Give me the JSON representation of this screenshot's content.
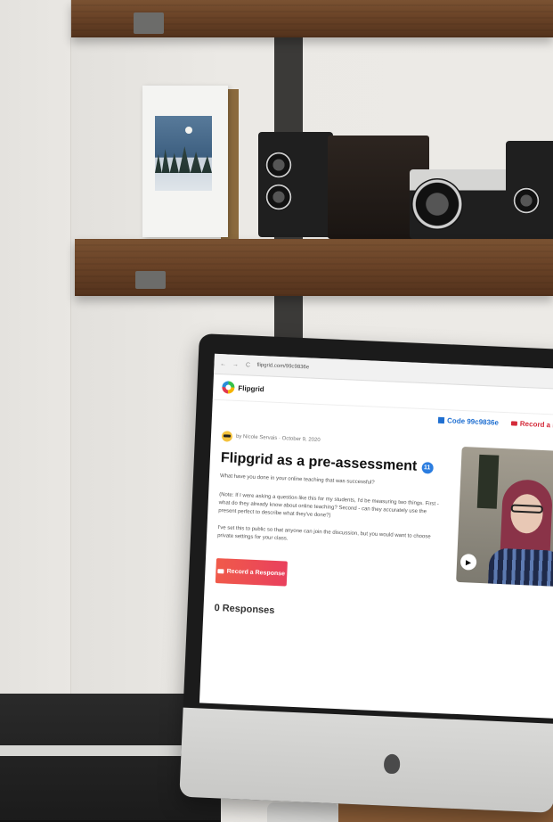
{
  "browser": {
    "url": "flipgrid.com/99c9836e",
    "nav_back": "←",
    "nav_forward": "→",
    "reload": "C"
  },
  "app": {
    "brand": "Flipgrid",
    "code_label": "Code 99c9836e",
    "record_top_label": "Record a Resp",
    "meta": "by Nicole Servais · October 9, 2020",
    "title": "Flipgrid as a pre-assessment",
    "title_badge": "11",
    "prompt": "What have you done in your online teaching that was successful?",
    "body": "(Note: If I were asking a question like this for my students, I'd be measuring two things. First - what do they already know about online teaching? Second - can they accurately use the present perfect to describe what they've done?)",
    "note": "I've set this to public so that anyone can join the discussion, but you would want to choose private settings for your class.",
    "record_button": "Record a Response",
    "responses": "0 Responses",
    "play_icon": "▶"
  },
  "colors": {
    "accent_blue": "#1f6fd1",
    "record_red": "#d42b3a",
    "button_gradient_start": "#f05a4a",
    "button_gradient_end": "#e9405d"
  },
  "icons": [
    "flipgrid-logo-icon",
    "sunglasses-emoji-icon",
    "code-icon",
    "camera-icon",
    "play-icon"
  ]
}
